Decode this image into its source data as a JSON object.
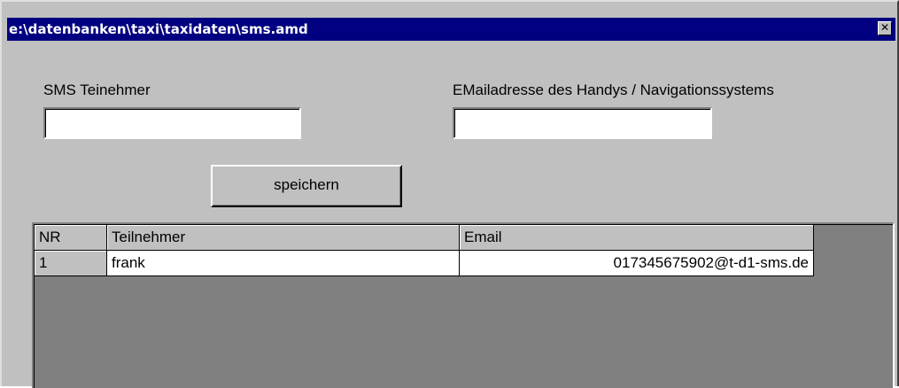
{
  "window": {
    "title": "e:\\datenbanken\\taxi\\taxidaten\\sms.amd",
    "close_glyph": "✕"
  },
  "form": {
    "participant_label": "SMS Teinehmer",
    "participant_value": "",
    "email_label": "EMailadresse des Handys / Navigationssystems",
    "email_value": "",
    "save_label": "speichern"
  },
  "table": {
    "columns": [
      "NR",
      "Teilnehmer",
      "Email"
    ],
    "rows": [
      {
        "nr": "1",
        "name": "frank",
        "email": "017345675902@t-d1-sms.de"
      }
    ]
  },
  "colors": {
    "titlebar": "#000080",
    "face": "#c0c0c0",
    "grid_empty": "#808080"
  }
}
